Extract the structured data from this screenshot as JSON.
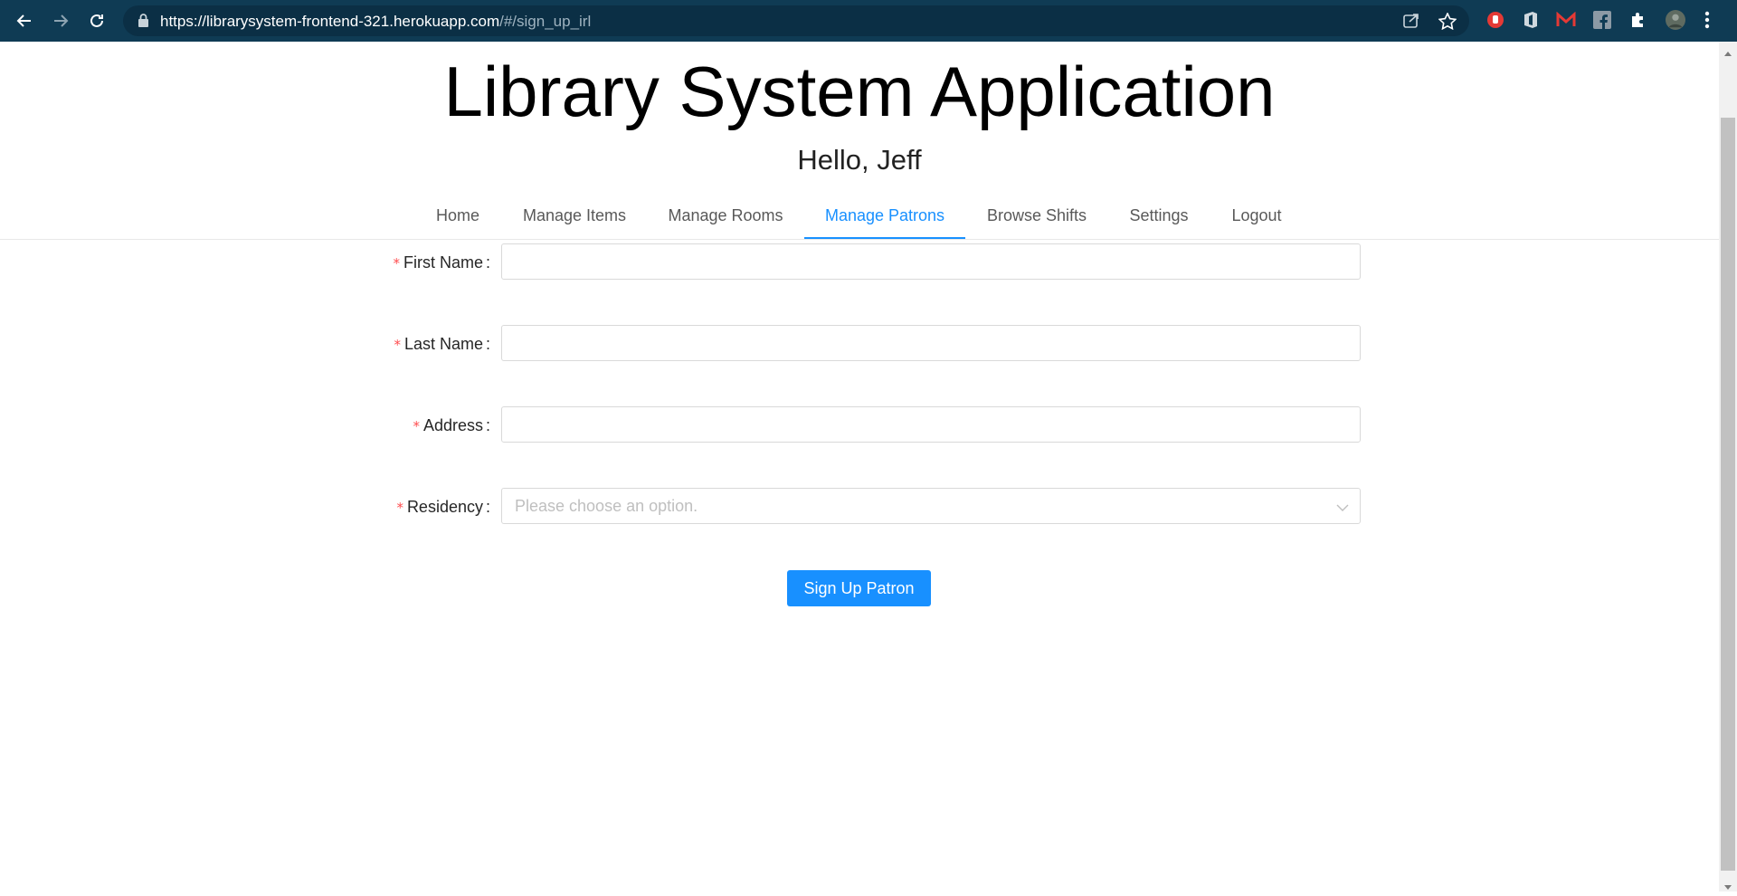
{
  "browser": {
    "url_host": "https://librarysystem-frontend-321.herokuapp.com",
    "url_path": "/#/sign_up_irl"
  },
  "header": {
    "title": "Library System Application",
    "greeting": "Hello, Jeff"
  },
  "nav": {
    "tabs": [
      {
        "label": "Home"
      },
      {
        "label": "Manage Items"
      },
      {
        "label": "Manage Rooms"
      },
      {
        "label": "Manage Patrons"
      },
      {
        "label": "Browse Shifts"
      },
      {
        "label": "Settings"
      },
      {
        "label": "Logout"
      }
    ],
    "active": "Manage Patrons"
  },
  "form": {
    "required_mark": "*",
    "fields": [
      {
        "label": "First Name",
        "value": ""
      },
      {
        "label": "Last Name",
        "value": ""
      },
      {
        "label": "Address",
        "value": ""
      },
      {
        "label": "Residency",
        "placeholder": "Please choose an option."
      }
    ],
    "submit_label": "Sign Up Patron"
  },
  "colors": {
    "chrome": "#0f3b54",
    "accent": "#1890ff",
    "required": "#ff4d4f"
  }
}
